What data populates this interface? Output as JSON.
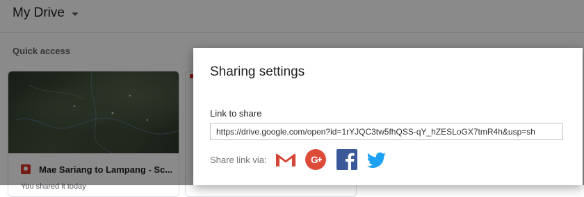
{
  "drive": {
    "title": "My Drive",
    "quick_access_label": "Quick access",
    "file_card": {
      "name": "Mae Sariang to Lampang - Sc...",
      "subtitle": "You shared it today"
    }
  },
  "dialog": {
    "title": "Sharing settings",
    "link_label": "Link to share",
    "link_value": "https://drive.google.com/open?id=1rYJQC3tw5fhQSS-qY_hZESLoGX7tmR4h&usp=sh",
    "share_via_label": "Share link via:",
    "share_icons": [
      "gmail-icon",
      "google-plus-icon",
      "facebook-icon",
      "twitter-icon"
    ]
  },
  "colors": {
    "gmail_red": "#d44638",
    "google_plus_red": "#dd4b39",
    "facebook_blue": "#3b5998",
    "twitter_blue": "#1da1f2"
  }
}
